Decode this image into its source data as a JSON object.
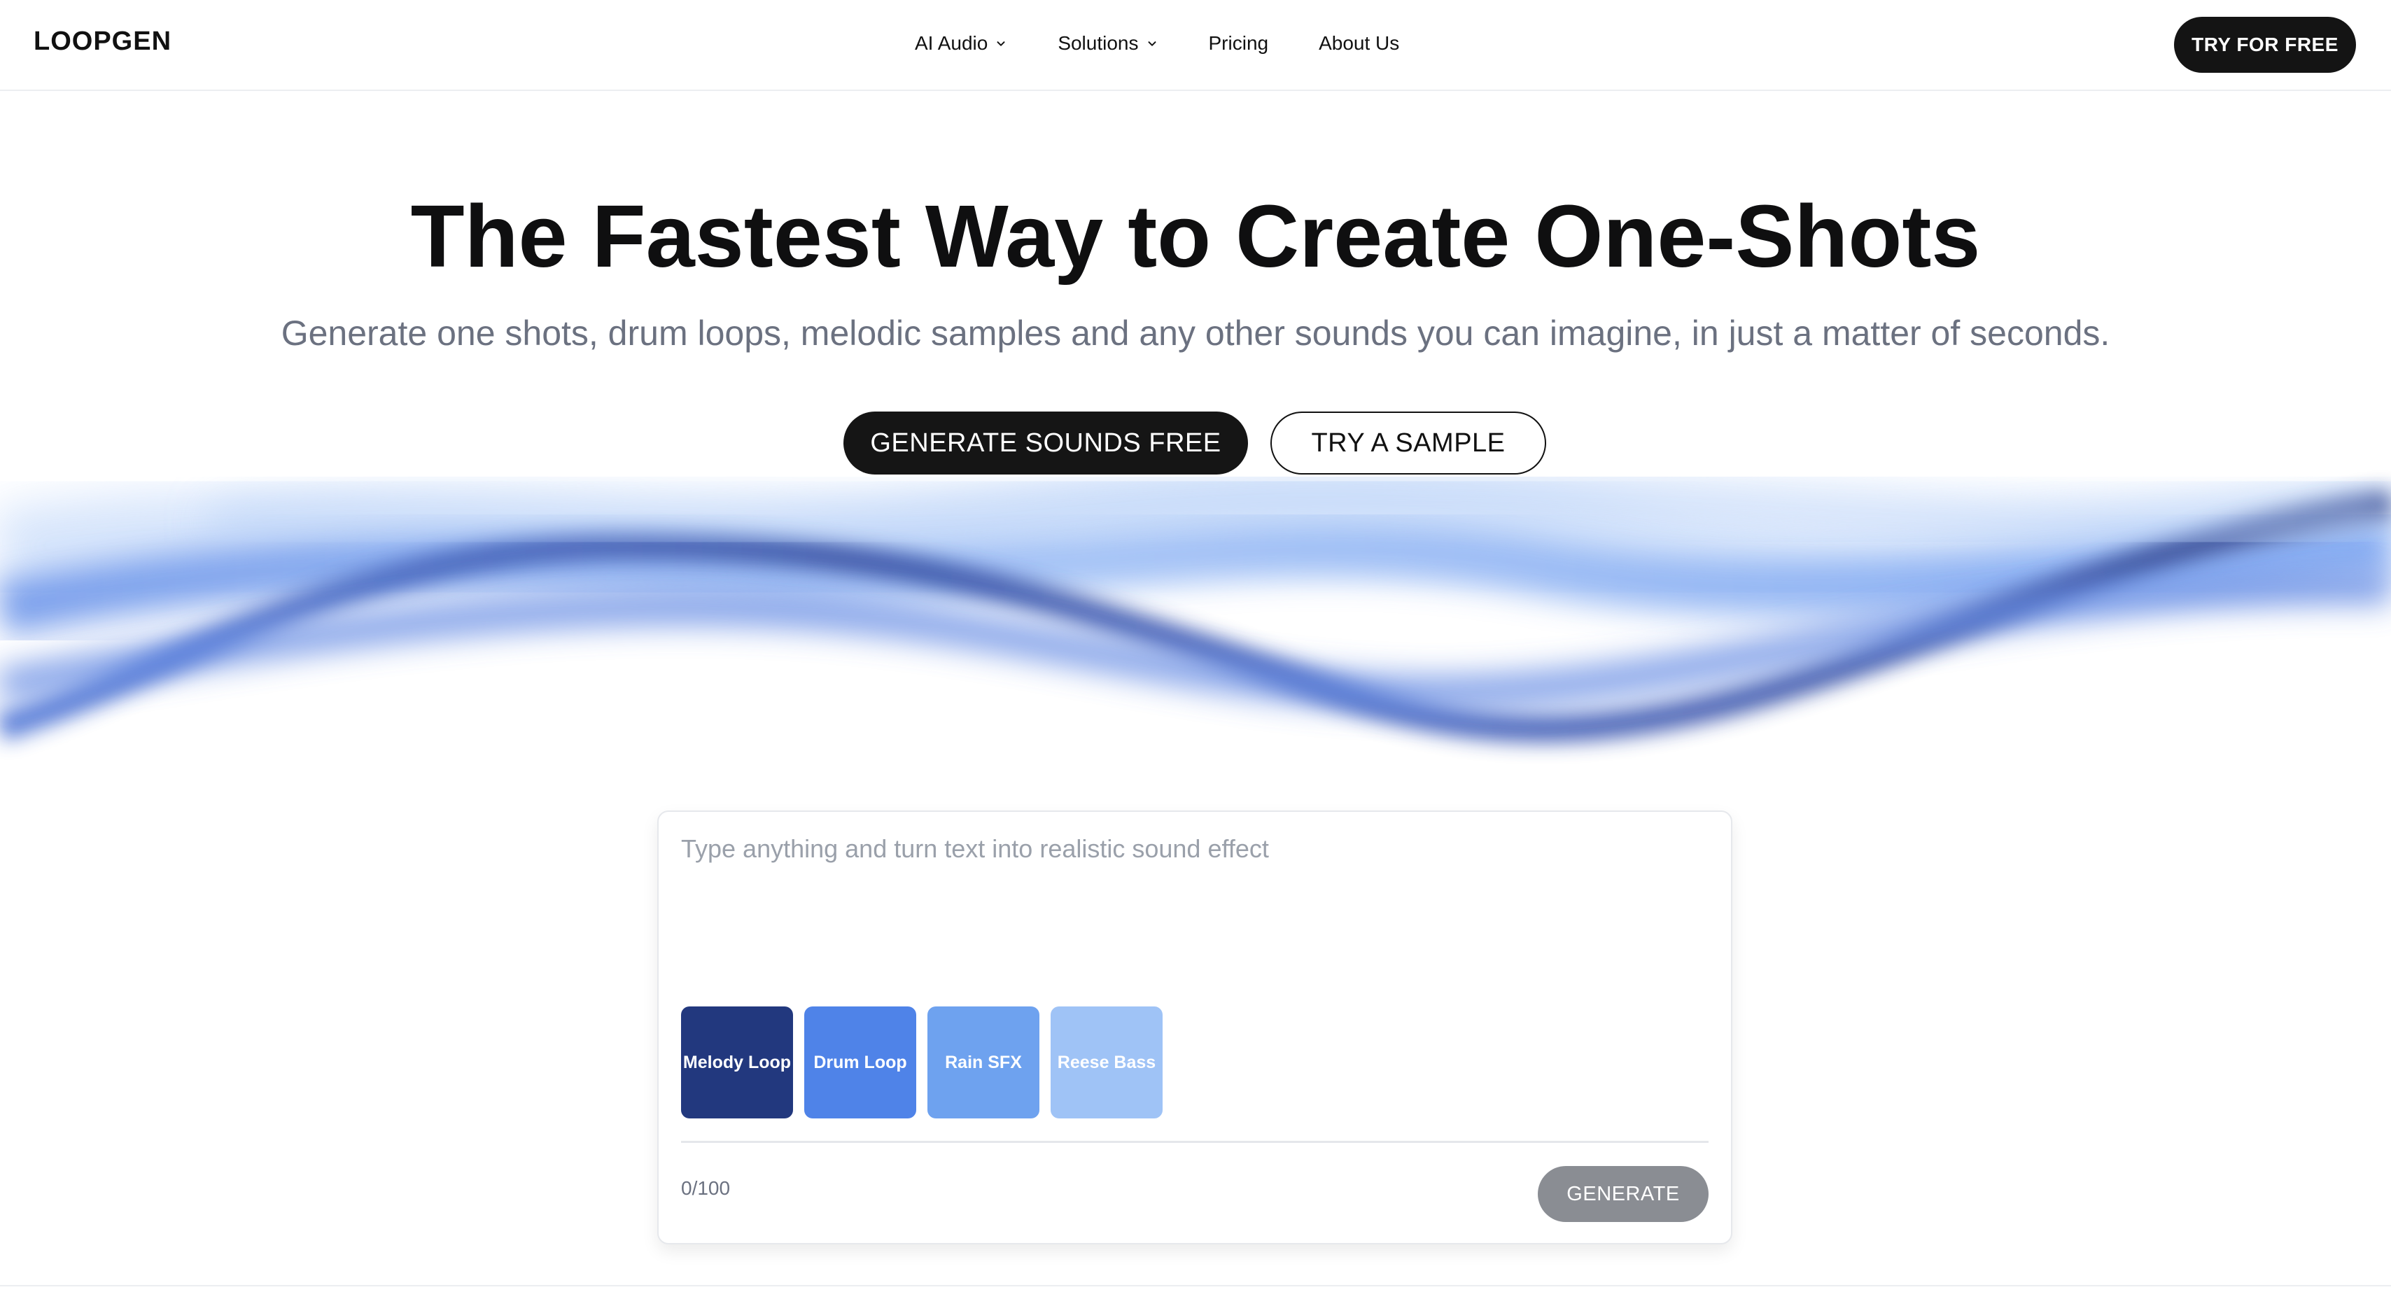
{
  "nav": {
    "logo": "LOOPGEN",
    "items": [
      {
        "label": "AI Audio",
        "has_dropdown": true,
        "icon": "chevron-down-icon"
      },
      {
        "label": "Solutions",
        "has_dropdown": true,
        "icon": "chevron-down-icon"
      },
      {
        "label": "Pricing",
        "has_dropdown": false
      },
      {
        "label": "About Us",
        "has_dropdown": false
      }
    ],
    "cta_label": "TRY FOR FREE"
  },
  "hero": {
    "title": "The Fastest Way to Create One-Shots",
    "subtitle": "Generate one shots, drum loops, melodic samples and any other sounds you can imagine, in just a matter of seconds.",
    "primary_cta": "GENERATE SOUNDS FREE",
    "secondary_cta": "TRY A SAMPLE"
  },
  "generator": {
    "input_value": "",
    "placeholder": "Type anything and turn text into realistic sound effect",
    "presets": [
      {
        "label": "Melody Loop",
        "color": "#22387e"
      },
      {
        "label": "Drum Loop",
        "color": "#4f83e8"
      },
      {
        "label": "Rain SFX",
        "color": "#6ea2ef"
      },
      {
        "label": "Reese Bass",
        "color": "#9fc3f6"
      }
    ],
    "char_count": "0/100",
    "generate_label": "GENERATE"
  },
  "colors": {
    "dark_button": "#141414",
    "muted_text": "#6b7180",
    "disabled_button": "#8a8d93",
    "wave_light": "#8fb4f5",
    "wave_dark": "#3e5bb8"
  }
}
